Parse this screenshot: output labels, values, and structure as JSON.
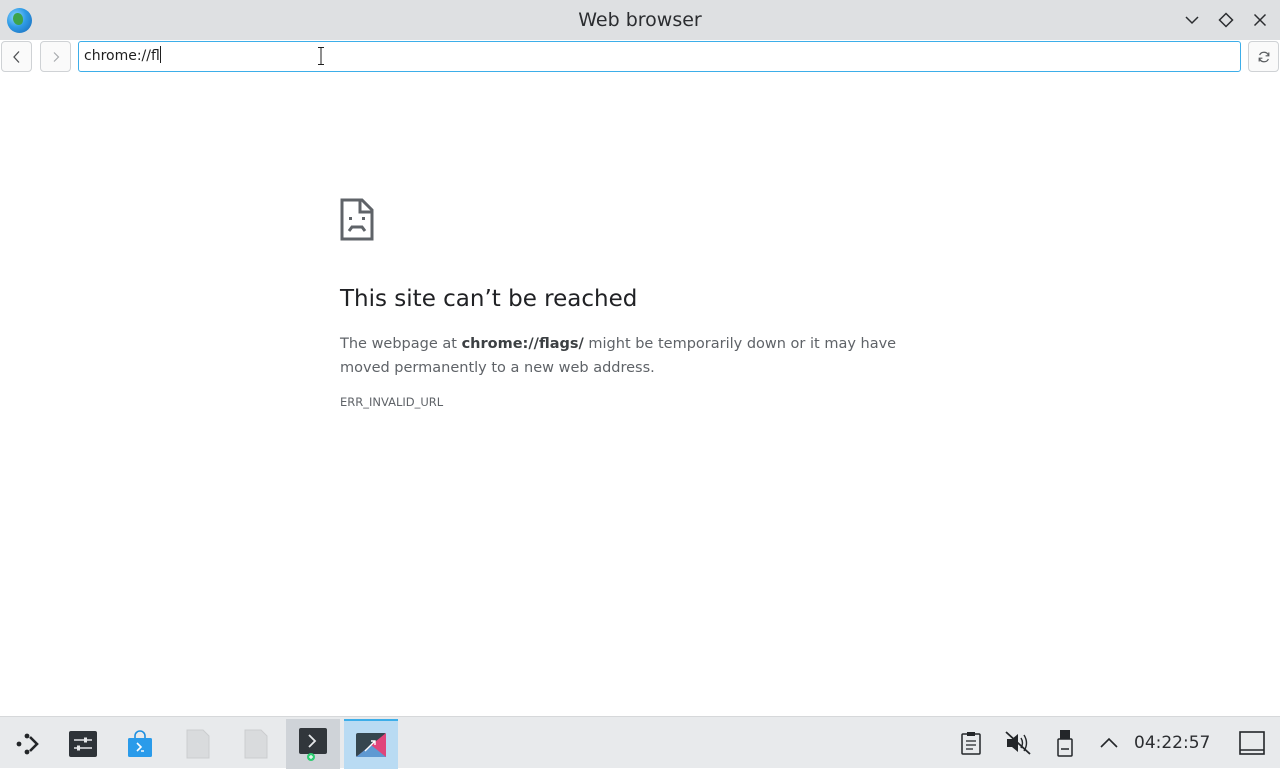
{
  "window": {
    "title": "Web browser",
    "icon": "globe-icon",
    "controls": [
      "minimize-icon",
      "maximize-icon",
      "close-icon"
    ]
  },
  "toolbar": {
    "back_icon": "chevron-left-icon",
    "forward_icon": "chevron-right-icon",
    "url_value": "chrome://fl",
    "reload_icon": "reload-icon"
  },
  "error_page": {
    "icon": "sad-page-icon",
    "title": "This site can’t be reached",
    "text_before": "The webpage at ",
    "url": "chrome://flags/",
    "text_after": " might be temporarily down or it may have moved permanently to a new web address.",
    "code": "ERR_INVALID_URL"
  },
  "taskbar": {
    "launcher_icon": "application-launcher-icon",
    "apps": [
      {
        "name": "system-settings",
        "icon": "settings-sliders-icon"
      },
      {
        "name": "software-store",
        "icon": "store-bag-icon"
      },
      {
        "name": "file-1",
        "icon": "blank-file-icon"
      },
      {
        "name": "file-2",
        "icon": "blank-file-icon"
      },
      {
        "name": "terminal",
        "icon": "terminal-icon"
      },
      {
        "name": "web-browser",
        "icon": "browser-icon"
      }
    ],
    "tray": [
      "clipboard-icon",
      "volume-muted-icon",
      "removable-device-icon",
      "expand-tray-icon"
    ],
    "clock": "04:22:57",
    "show_desktop_icon": "show-desktop-icon"
  },
  "colors": {
    "accent": "#3daee9",
    "titlebar": "#dee0e2",
    "taskbar": "#e8eaec"
  }
}
